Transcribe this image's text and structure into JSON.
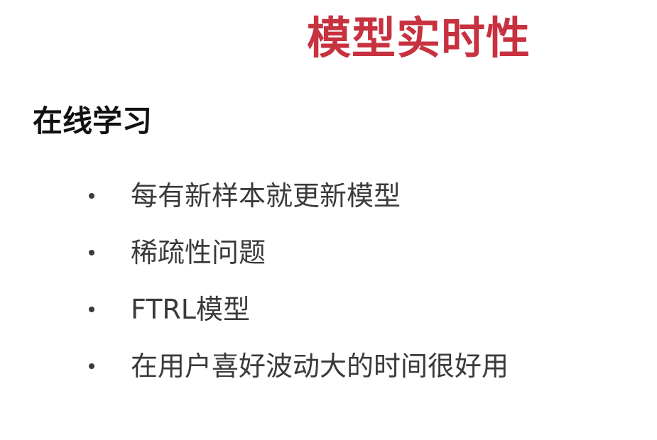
{
  "slide": {
    "title": "模型实时性",
    "subtitle": "在线学习",
    "bullets": [
      "每有新样本就更新模型",
      "稀疏性问题",
      "FTRL模型",
      "在用户喜好波动大的时间很好用"
    ]
  },
  "colors": {
    "title": "#c8313f",
    "subtitle": "#111111",
    "bullet_text": "#3a3a3a",
    "bullet_dot": "#3a3a3a",
    "background": "#ffffff"
  }
}
